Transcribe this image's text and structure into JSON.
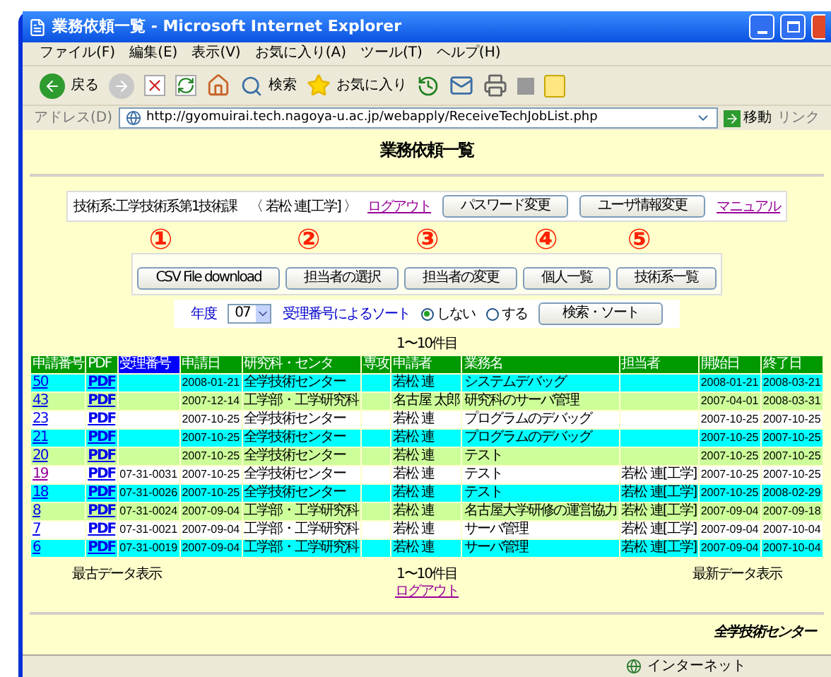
{
  "window": {
    "title": "業務依頼一覧 - Microsoft Internet Explorer"
  },
  "menu": [
    "ファイル(F)",
    "編集(E)",
    "表示(V)",
    "お気に入り(A)",
    "ツール(T)",
    "ヘルプ(H)"
  ],
  "toolbar": {
    "back": "戻る",
    "search": "検索",
    "favorites": "お気に入り"
  },
  "address": {
    "label": "アドレス(D)",
    "value": "http://gyomuirai.tech.nagoya-u.ac.jp/webapply/ReceiveTechJobList.php",
    "go": "移動",
    "links": "リンク"
  },
  "page": {
    "title": "業務依頼一覧",
    "user": {
      "text": "技術系:工学技術系第1技術課　〈 若松 連[工学] 〉",
      "logout": "ログアウト",
      "buttons": [
        "パスワード変更",
        "ユーザ情報変更"
      ],
      "manual": "マニュアル"
    },
    "actions": [
      {
        "label": "CSV File download",
        "annotation": "①"
      },
      {
        "label": "担当者の選択",
        "annotation": "②"
      },
      {
        "label": "担当者の変更",
        "annotation": "③"
      },
      {
        "label": "個人一覧",
        "annotation": "④"
      },
      {
        "label": "技術系一覧",
        "annotation": "⑤"
      }
    ],
    "filter": {
      "year_label": "年度",
      "year": "07",
      "sort_label": "受理番号によるソート",
      "options": [
        {
          "label": "しない",
          "selected": true
        },
        {
          "label": "する",
          "selected": false
        }
      ],
      "button": "検索・ソート"
    },
    "range_top": "1〜10件目",
    "table": {
      "columns": [
        {
          "label": "申請番号",
          "selected": false
        },
        {
          "label": "PDF",
          "selected": false
        },
        {
          "label": "受理番号",
          "selected": true
        },
        {
          "label": "申請日",
          "selected": false
        },
        {
          "label": "研究科・センタ",
          "selected": false
        },
        {
          "label": "専攻",
          "selected": false
        },
        {
          "label": "申請者",
          "selected": false
        },
        {
          "label": "業務名",
          "selected": false
        },
        {
          "label": "担当者",
          "selected": false
        },
        {
          "label": "開始日",
          "selected": false
        },
        {
          "label": "終了日",
          "selected": false
        }
      ],
      "rows": [
        {
          "id": "50",
          "visited": false,
          "pdf": "PDF",
          "date": "2008-01-21",
          "dept": "全学技術センター",
          "applicant": "若松 連",
          "job": "システムデバッグ",
          "start": "2008-01-21",
          "end": "2008-03-21",
          "color": "#00ffff"
        },
        {
          "id": "43",
          "visited": false,
          "pdf": "PDF",
          "date": "2007-12-14",
          "dept": "工学部・工学研究科",
          "applicant": "名古屋 太郎",
          "job": "研究科のサーバ管理",
          "start": "2007-04-01",
          "end": "2008-03-31",
          "color": "#ccff99"
        },
        {
          "id": "23",
          "visited": false,
          "pdf": "PDF",
          "date": "2007-10-25",
          "dept": "全学技術センター",
          "applicant": "若松 連",
          "job": "プログラムのデバッグ",
          "start": "2007-10-25",
          "end": "2007-10-25",
          "color": "#ffffff"
        },
        {
          "id": "21",
          "visited": false,
          "pdf": "PDF",
          "date": "2007-10-25",
          "dept": "全学技術センター",
          "applicant": "若松 連",
          "job": "プログラムのデバッグ",
          "start": "2007-10-25",
          "end": "2007-10-25",
          "color": "#00ffff"
        },
        {
          "id": "20",
          "visited": false,
          "pdf": "PDF",
          "date": "2007-10-25",
          "dept": "全学技術センター",
          "applicant": "若松 連",
          "job": "テスト",
          "start": "2007-10-25",
          "end": "2007-10-25",
          "color": "#ccff99"
        },
        {
          "id": "19",
          "visited": true,
          "pdf": "PDF",
          "receipt": "07-31-0031",
          "date": "2007-10-25",
          "dept": "全学技術センター",
          "applicant": "若松 連",
          "job": "テスト",
          "assignee": "若松 連[工学]",
          "start": "2007-10-25",
          "end": "2007-10-25",
          "color": "#ffffff"
        },
        {
          "id": "18",
          "visited": false,
          "pdf": "PDF",
          "receipt": "07-31-0026",
          "date": "2007-10-25",
          "dept": "全学技術センター",
          "applicant": "若松 連",
          "job": "テスト",
          "assignee": "若松 連[工学]",
          "start": "2007-10-25",
          "end": "2008-02-29",
          "color": "#00ffff"
        },
        {
          "id": "8",
          "visited": false,
          "pdf": "PDF",
          "receipt": "07-31-0024",
          "date": "2007-09-04",
          "dept": "工学部・工学研究科",
          "applicant": "若松 連",
          "job": "名古屋大学研修の運営協力",
          "assignee": "若松 連[工学]",
          "start": "2007-09-04",
          "end": "2007-09-18",
          "color": "#ccff99"
        },
        {
          "id": "7",
          "visited": false,
          "pdf": "PDF",
          "receipt": "07-31-0021",
          "date": "2007-09-04",
          "dept": "工学部・工学研究科",
          "applicant": "若松 連",
          "job": "サーバ管理",
          "assignee": "若松 連[工学]",
          "start": "2007-09-04",
          "end": "2007-10-04",
          "color": "#ffffff"
        },
        {
          "id": "6",
          "visited": false,
          "pdf": "PDF",
          "receipt": "07-31-0019",
          "date": "2007-09-04",
          "dept": "工学部・工学研究科",
          "applicant": "若松 連",
          "job": "サーバ管理",
          "assignee": "若松 連[工学]",
          "start": "2007-09-04",
          "end": "2007-10-04",
          "color": "#00ffff"
        }
      ]
    },
    "footer": {
      "oldest": "最古データ表示",
      "range": "1〜10件目",
      "logout": "ログアウト",
      "newest": "最新データ表示"
    },
    "signature": "全学技術センター"
  },
  "status_bar": {
    "zone": "インターネット"
  }
}
